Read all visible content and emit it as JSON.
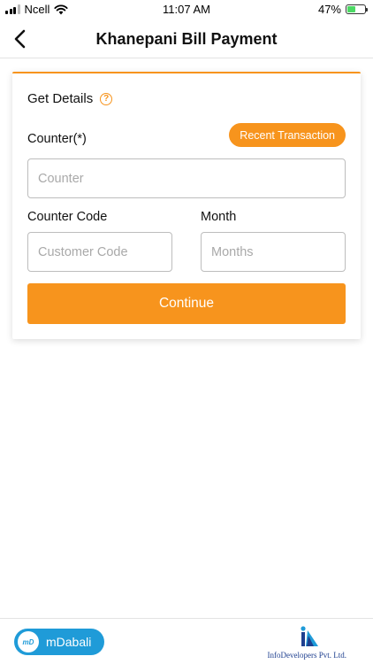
{
  "status_bar": {
    "carrier": "Ncell",
    "time": "11:07 AM",
    "battery_percent": "47%",
    "battery_level": 0.47,
    "signal_bars": 3
  },
  "nav": {
    "title": "Khanepani Bill Payment",
    "back_icon": "chevron-left-icon"
  },
  "card": {
    "heading": "Get Details",
    "help_icon": "question-circle-icon",
    "help_glyph": "?",
    "counter_label": "Counter(*)",
    "recent_transaction_label": "Recent Transaction",
    "counter_placeholder": "Counter",
    "counter_value": "",
    "counter_code_label": "Counter Code",
    "customer_code_placeholder": "Customer Code",
    "customer_code_value": "",
    "month_label": "Month",
    "months_placeholder": "Months",
    "months_value": "",
    "continue_label": "Continue"
  },
  "footer": {
    "left_logo_mark": "mD",
    "left_logo_text": "mDabali",
    "right_logo_text": "InfoDevelopers Pvt. Ltd."
  },
  "colors": {
    "accent": "#f7941d",
    "mdabali_blue": "#1f9bd8",
    "infodev_navy": "#1e3f8f"
  }
}
